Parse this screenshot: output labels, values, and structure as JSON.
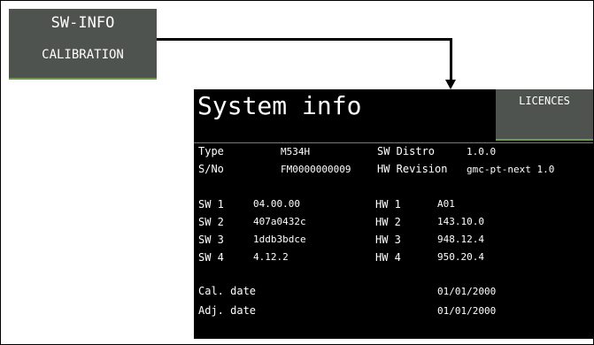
{
  "menu": {
    "sw_info_label": "SW-INFO",
    "calibration_label": "CALIBRATION"
  },
  "screen": {
    "title": "System info",
    "licences_label": "LICENCES",
    "type_label": "Type",
    "type_value": "M534H",
    "serial_label": "S/No",
    "serial_value": "FM0000000009",
    "sw_distro_label": "SW Distro",
    "sw_distro_value": "1.0.0",
    "hw_revision_label": "HW Revision",
    "hw_revision_value": "gmc-pt-next 1.0",
    "sw": [
      {
        "label": "SW 1",
        "value": "04.00.00"
      },
      {
        "label": "SW 2",
        "value": "407a0432c"
      },
      {
        "label": "SW 3",
        "value": "1ddb3bdce"
      },
      {
        "label": "SW 4",
        "value": "4.12.2"
      }
    ],
    "hw": [
      {
        "label": "HW 1",
        "value": "A01"
      },
      {
        "label": "HW 2",
        "value": "143.10.0"
      },
      {
        "label": "HW 3",
        "value": "948.12.4"
      },
      {
        "label": "HW 4",
        "value": "950.20.4"
      }
    ],
    "cal_date_label": "Cal. date",
    "cal_date_value": "01/01/2000",
    "adj_date_label": "Adj. date",
    "adj_date_value": "01/01/2000"
  },
  "colors": {
    "button_bg": "#4f5350",
    "accent_line": "#6f9a4a",
    "divider": "#b56b2a",
    "screen_bg": "#000000"
  }
}
